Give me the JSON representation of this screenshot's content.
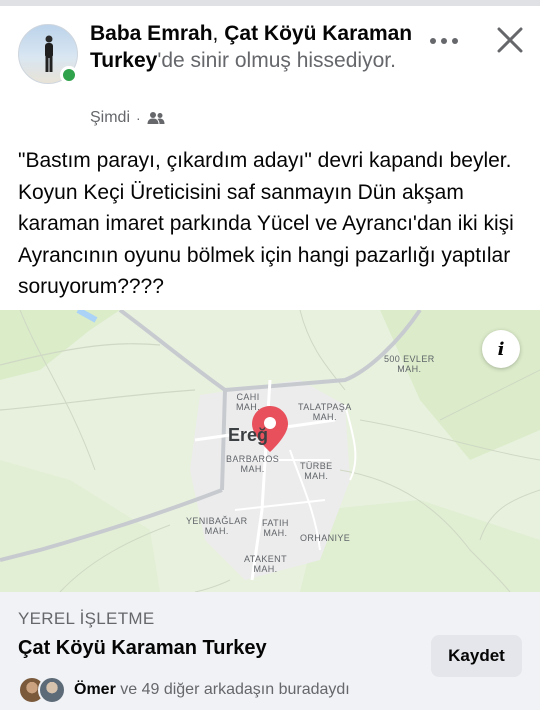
{
  "post": {
    "author": "Baba Emrah",
    "title_separator": ",",
    "place": "Çat Köyü Karaman Turkey",
    "title_rest": "'de sinir olmuş hissediyor.",
    "timestamp": "Şimdi",
    "body": "\"Bastım parayı, çıkardım adayı\" devri kapandı beyler. Koyun Keçi Üreticisini saf sanmayın Dün akşam karaman imaret parkında Yücel ve Ayrancı'dan iki kişi Ayrancının oyunu bölmek için hangi pazarlığı yaptılar soruyorum????"
  },
  "icons": {
    "more": "more-horizontal-icon",
    "close": "close-icon",
    "audience": "friends-audience-icon",
    "info": "info-icon",
    "pin": "map-pin-icon"
  },
  "map": {
    "city": "Ereğ",
    "neighborhoods": {
      "evler": "500 EVLER\nMAH.",
      "cahi": "CAHI\nMAH.",
      "talatpasa": "TALATPAŞA\nMAH.",
      "barbaros": "BARBAROS\nMAH.",
      "turbe": "TÜRBE\nMAH.",
      "yenibaglar": "YENIBAĞLAR\nMAH.",
      "fatih": "FATIH\nMAH.",
      "orhaniye": "ORHANIYE",
      "atakent": "ATAKENT\nMAH."
    },
    "info_label": "i"
  },
  "card": {
    "kicker": "YEREL İŞLETME",
    "title": "Çat Köyü Karaman Turkey",
    "save_label": "Kaydet",
    "friend_name": "Ömer",
    "friends_rest": " ve 49 diğer arkadaşın buradaydı"
  },
  "colors": {
    "online": "#31a24c",
    "pin": "#e8505b",
    "card_bg": "#f0f2f5"
  }
}
